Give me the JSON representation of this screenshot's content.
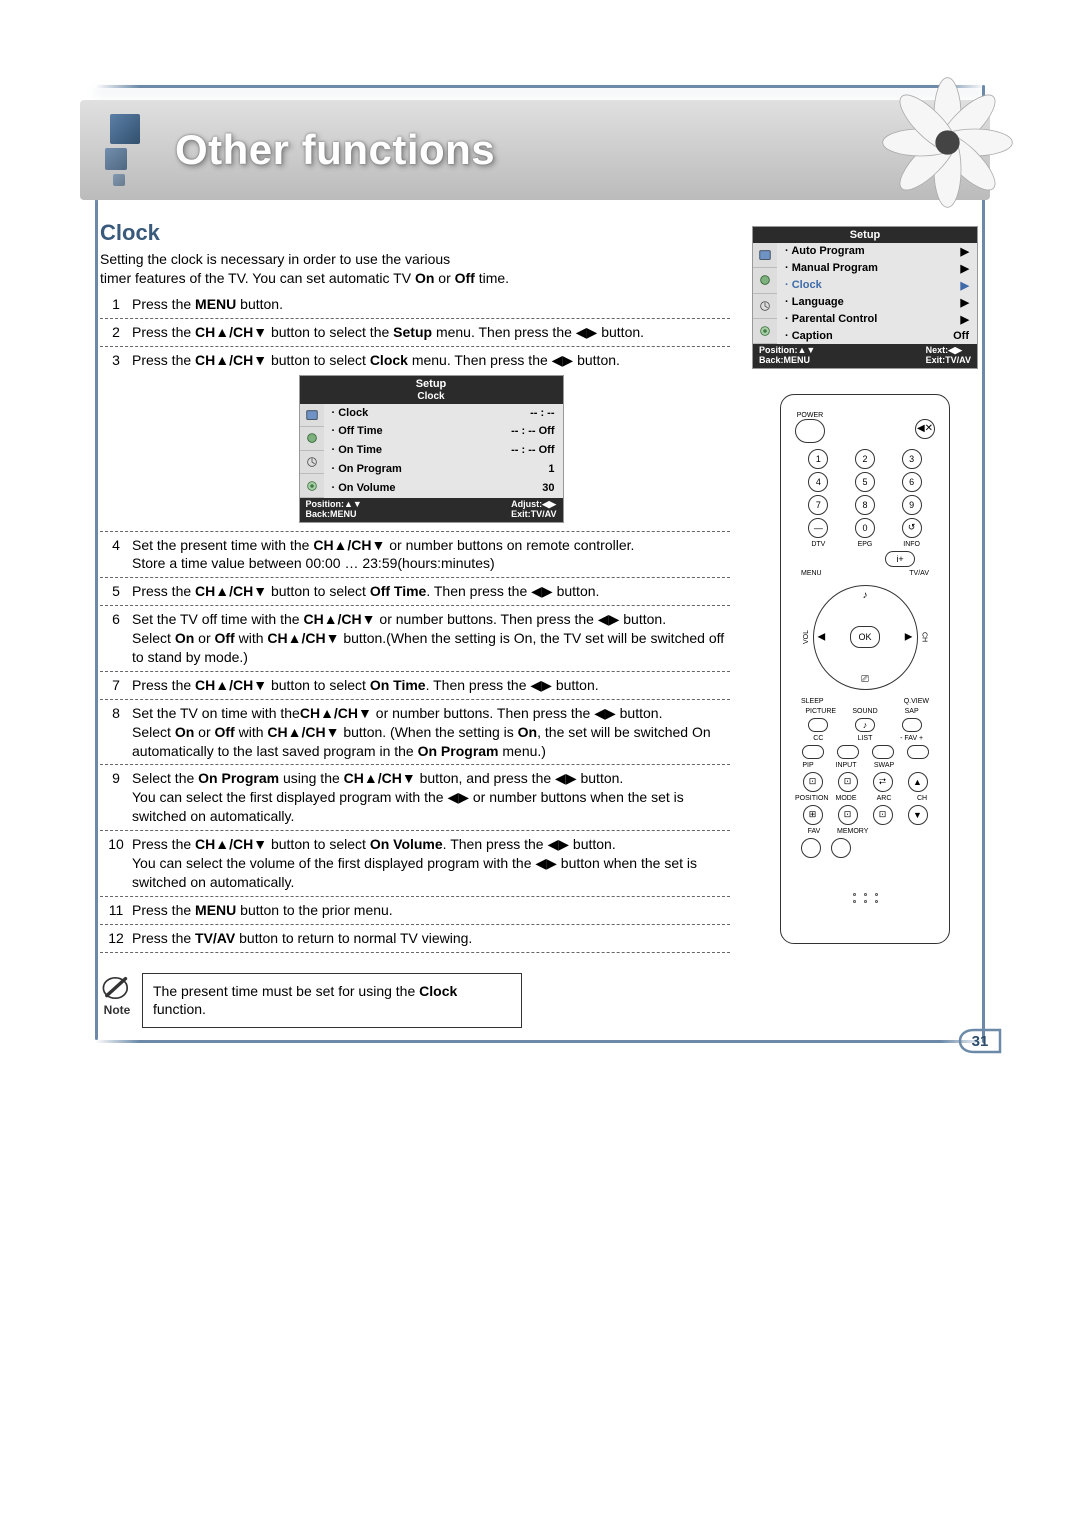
{
  "header": {
    "title": "Other functions"
  },
  "section": {
    "title": "Clock"
  },
  "intro_a": "Setting the clock is necessary in order to use the various",
  "intro_b": "timer features of the TV. You can set automatic TV ",
  "intro_b_on": "On",
  "intro_b_or": " or ",
  "intro_b_off": "Off",
  "intro_b_end": " time.",
  "steps": {
    "s1": {
      "n": "1",
      "a": "Press the ",
      "b": "MENU",
      "c": " button."
    },
    "s2": {
      "n": "2",
      "a": "Press the ",
      "b": "CH▲/CH▼",
      "c": " button to select the ",
      "d": "Setup",
      "e": " menu. Then press the ",
      "lr": "◀▶",
      "g": " button."
    },
    "s3": {
      "n": "3",
      "a": "Press the ",
      "b": "CH▲/CH▼",
      "c": " button to select ",
      "d": "Clock",
      "e": " menu. Then press the ",
      "lr": "◀▶",
      "g": " button."
    },
    "s4": {
      "n": "4",
      "a": "Set the present time with the ",
      "b": "CH▲/CH▼",
      "c": " or number buttons on remote controller.",
      "d": "Store a time value between 00:00 … 23:59(hours:minutes)"
    },
    "s5": {
      "n": "5",
      "a": "Press the ",
      "b": "CH▲/CH▼",
      "c": " button to select ",
      "d": "Off Time",
      "e": ". Then press the ",
      "lr": "◀▶",
      "g": " button."
    },
    "s6": {
      "n": "6",
      "a": "Set the TV off time with the ",
      "b": "CH▲/CH▼",
      "c": " or number buttons. Then press the ",
      "lr": "◀▶",
      "e": " button.",
      "f": "Select ",
      "on": "On",
      "or": " or ",
      "off": "Off",
      "g": " with ",
      "h": "CH▲/CH▼",
      "i": " button.(When the setting is On, the TV set will be switched off to stand by mode.)"
    },
    "s7": {
      "n": "7",
      "a": "Press the ",
      "b": "CH▲/CH▼",
      "c": " button to select ",
      "d": "On Time",
      "e": ". Then press the ",
      "lr": "◀▶",
      "g": " button."
    },
    "s8": {
      "n": "8",
      "a": "Set the TV on time with the",
      "b": "CH▲/CH▼",
      "c": " or number buttons. Then press the ",
      "lr": "◀▶",
      "e": " button.",
      "f": "Select ",
      "on": "On",
      "or": " or ",
      "off": "Off",
      "g": " with ",
      "h": "CH▲/CH▼",
      "i": " button. (When the setting is ",
      "on2": "On",
      "j": ", the set will be switched On automatically to the last saved program in the ",
      "k": "On Program",
      "l": " menu.)"
    },
    "s9": {
      "n": "9",
      "a": "Select the ",
      "b": "On Program",
      "c": " using the ",
      "d": "CH▲/CH▼",
      "e": " button, and press the ",
      "lr": "◀▶",
      "g": " button.",
      "h": "You can select the first displayed program with the ",
      "lr2": "◀▶",
      "i": " or number buttons when the set is switched on automatically."
    },
    "s10": {
      "n": "10",
      "a": "Press the ",
      "b": "CH▲/CH▼",
      "c": " button to select ",
      "d": "On Volume",
      "e": ". Then press the ",
      "lr": "◀▶",
      "g": " button.",
      "h": "You can select the volume of the first displayed program with the ",
      "lr2": "◀▶",
      "i": " button when the set is switched on automatically."
    },
    "s11": {
      "n": "11",
      "a": "Press the ",
      "b": "MENU",
      "c": " button to the prior menu."
    },
    "s12": {
      "n": "12",
      "a": "Press the ",
      "b": "TV/AV",
      "c": " button to return to normal TV viewing."
    }
  },
  "clock_osd": {
    "title": "Setup",
    "sub": "Clock",
    "rows": [
      {
        "k": "Clock",
        "v": "-- : --"
      },
      {
        "k": "Off Time",
        "v": "-- : --     Off"
      },
      {
        "k": "On Time",
        "v": "-- : --     Off"
      },
      {
        "k": "On Program",
        "v": "1"
      },
      {
        "k": "On Volume",
        "v": "30"
      }
    ],
    "foot_l": "Position:▲▼\nBack:MENU",
    "foot_r": "Adjust:◀▶\nExit:TV/AV"
  },
  "setup_osd": {
    "title": "Setup",
    "rows": [
      {
        "k": "Auto Program",
        "v": "▶"
      },
      {
        "k": "Manual Program",
        "v": "▶"
      },
      {
        "k": "Clock",
        "v": "▶",
        "hl": true
      },
      {
        "k": "Language",
        "v": "▶"
      },
      {
        "k": "Parental Control",
        "v": "▶"
      },
      {
        "k": "Caption",
        "v": "Off"
      }
    ],
    "foot_l": "Position:▲▼\nBack:MENU",
    "foot_r": "Next:◀▶\nExit:TV/AV"
  },
  "remote": {
    "power": "POWER",
    "mute": "◀✕",
    "numbers": [
      "1",
      "2",
      "3",
      "4",
      "5",
      "6",
      "7",
      "8",
      "9",
      "0"
    ],
    "dash": "—",
    "recall_icon": "↺",
    "labels_row1": [
      "DTV",
      "EPG",
      "INFO"
    ],
    "wide_btn": "i+",
    "menu": "MENU",
    "tvav": "TV/AV",
    "ok": "OK",
    "vol": "VOL",
    "ch": "CH",
    "dpad_up_icon": "♪",
    "dpad_dn_icon": "⎚",
    "sleep": "SLEEP",
    "qview": "Q.VIEW",
    "labels_row2": [
      "PICTURE",
      "SOUND",
      "SAP"
    ],
    "labels_row3": [
      "CC",
      "LIST",
      "- FAV +"
    ],
    "labels_row4": [
      "PIP",
      "INPUT",
      "SWAP"
    ],
    "labels_row5": [
      "POSITION",
      "MODE",
      "ARC",
      "CH"
    ],
    "labels_row6": [
      "FAV",
      "MEMORY"
    ]
  },
  "note": {
    "label": "Note",
    "a": "The present time must be set for using the ",
    "b": "Clock",
    "c": " function."
  },
  "page_number": "31"
}
